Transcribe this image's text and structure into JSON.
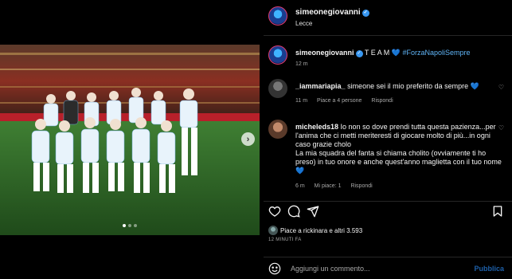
{
  "header": {
    "username": "simeonegiovanni",
    "location": "Lecce"
  },
  "caption": {
    "username": "simeonegiovanni",
    "text": "T E A M",
    "hashtag": "#ForzaNapoliSempre",
    "time": "12 m"
  },
  "comments": [
    {
      "username": "_iammariapia_",
      "text": "simeone sei il mio preferito da sempre",
      "emoji": "💙",
      "time": "11 m",
      "likes": "Piace a 4 persone",
      "reply": "Rispondi"
    },
    {
      "username": "micheleds18",
      "text": "Io non so dove prendi tutta questa pazienza...per l'anima che ci metti meriteresti di giocare molto di più...in ogni caso grazie cholo",
      "text2": "La mia squadra del fanta si chiama cholito (ovviamente ti ho preso) in tuo onore e anche quest'anno maglietta con il tuo nome",
      "emoji": "💙",
      "time": "6 m",
      "likes": "Mi piace: 1",
      "reply": "Rispondi"
    }
  ],
  "likes_summary": "Piace a rickinara e altri 3.593",
  "post_time": "12 MINUTI FA",
  "add_comment": {
    "placeholder": "Aggiungi un commento...",
    "publish": "Pubblica"
  },
  "carousel": {
    "count": 3,
    "active_index": 0
  },
  "icons": [
    "like-icon",
    "comment-icon",
    "share-icon",
    "save-icon",
    "emoji-icon",
    "verified-icon",
    "chevron-right-icon"
  ],
  "colors": {
    "accent": "#3897f0",
    "hashtag": "#5fb3f5",
    "background": "#000000"
  }
}
